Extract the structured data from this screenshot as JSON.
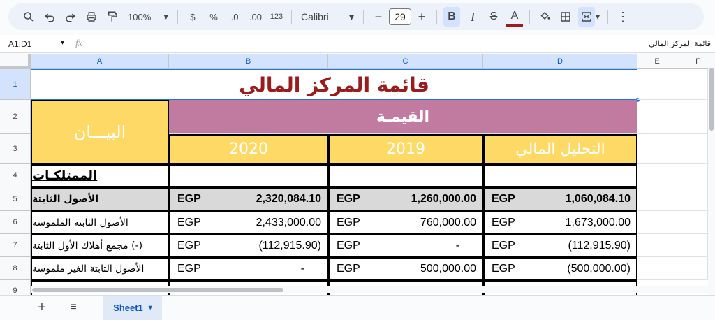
{
  "toolbar": {
    "zoom": "100%",
    "currency": "$",
    "percent": "%",
    "dec_decrease": ".0",
    "dec_increase": ".00",
    "format_123": "123",
    "font": "Calibri",
    "font_size": "29",
    "bold": "B",
    "italic": "I",
    "text_color": "A"
  },
  "formula_bar": {
    "name_box": "A1:D1",
    "fx": "fx",
    "value": "قائمة المركز المالي"
  },
  "columns": [
    "A",
    "B",
    "C",
    "D",
    "E",
    "F"
  ],
  "rows": [
    "1",
    "2",
    "3",
    "4",
    "5",
    "6",
    "7",
    "8",
    "9"
  ],
  "sheet": {
    "title": "قائمة المركز المالي",
    "bayan": "البيـــان",
    "qima": "القيمـة",
    "years": [
      "2020",
      "2019",
      "التحليل المالي"
    ],
    "assets_heading": "الممتلكـات",
    "currency": "EGP",
    "data_rows": [
      {
        "label": "الأصول الثابتة",
        "b": "2,320,084.10",
        "c": "1,260,000.00",
        "d": "1,060,084.10"
      },
      {
        "label": "الأصول الثابتة الملموسة",
        "b": "2,433,000.00",
        "c": "760,000.00",
        "d": "1,673,000.00"
      },
      {
        "label": "(-) مجمع أهلاك الأول الثابتة",
        "b": "(112,915.90)",
        "c": "-",
        "d": "(112,915.90)"
      },
      {
        "label": "الأصول الثابتة الغير ملموسة",
        "b": "-",
        "c": "500,000.00",
        "d": "(500,000.00)"
      }
    ]
  },
  "sheet_tab": "Sheet1",
  "colors": {
    "title": "#9b1c1c",
    "yellow": "#ffd966",
    "pink": "#c27ba0",
    "gray": "#d9d9d9"
  }
}
